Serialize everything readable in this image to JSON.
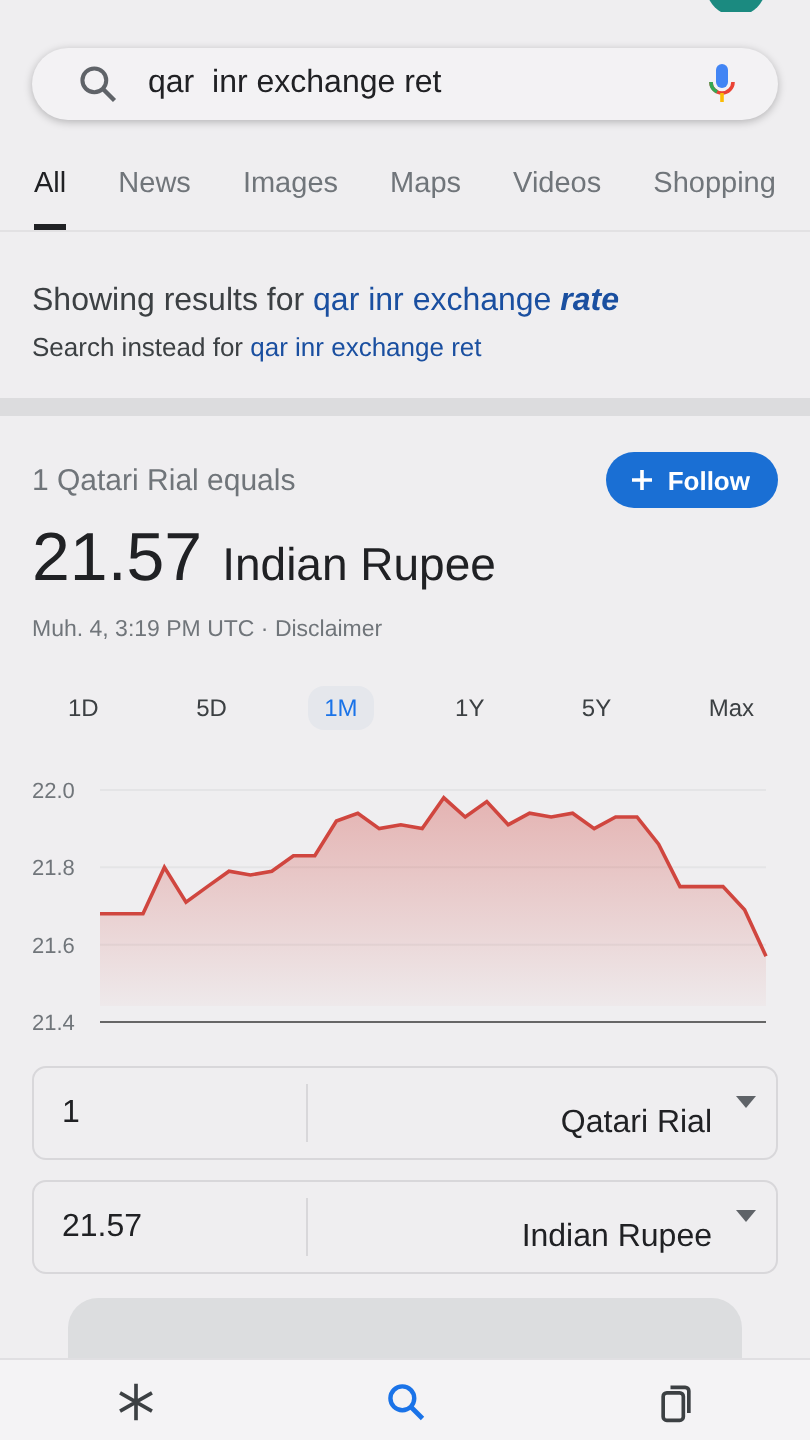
{
  "search": {
    "value": "qar  inr exchange ret"
  },
  "tabs": [
    {
      "label": "All",
      "selected": true
    },
    {
      "label": "News",
      "selected": false
    },
    {
      "label": "Images",
      "selected": false
    },
    {
      "label": "Maps",
      "selected": false
    },
    {
      "label": "Videos",
      "selected": false
    },
    {
      "label": "Shopping",
      "selected": false
    }
  ],
  "correction": {
    "showing_prefix": "Showing results for ",
    "showing_query": "qar inr exchange **rate**",
    "instead_prefix": "Search instead for ",
    "instead_query": "qar inr exchange ret"
  },
  "converter": {
    "equals_label": "1 Qatari Rial equals",
    "follow_label": "Follow",
    "value": "21.57",
    "currency": "Indian Rupee",
    "timestamp": "Muh. 4, 3:19 PM UTC · ",
    "disclaimer": "Disclaimer",
    "ranges": [
      {
        "label": "1D",
        "selected": false
      },
      {
        "label": "5D",
        "selected": false
      },
      {
        "label": "1M",
        "selected": true
      },
      {
        "label": "1Y",
        "selected": false
      },
      {
        "label": "5Y",
        "selected": false
      },
      {
        "label": "Max",
        "selected": false
      }
    ],
    "chart_data": {
      "type": "area",
      "series": [
        {
          "color": "#d0463f",
          "values": [
            21.68,
            21.68,
            21.68,
            21.8,
            21.71,
            21.75,
            21.79,
            21.78,
            21.79,
            21.83,
            21.83,
            21.92,
            21.94,
            21.9,
            21.91,
            21.9,
            21.98,
            21.93,
            21.97,
            21.91,
            21.94,
            21.93,
            21.94,
            21.9,
            21.93,
            21.93,
            21.86,
            21.75,
            21.75,
            21.75,
            21.69,
            21.57
          ]
        }
      ],
      "ylim": [
        21.4,
        22.0
      ],
      "yticks": [
        {
          "value": 22.0,
          "label": "22.0"
        },
        {
          "value": 21.8,
          "label": "21.8"
        },
        {
          "value": 21.6,
          "label": "21.6"
        },
        {
          "value": 21.4,
          "label": "21.4"
        }
      ]
    },
    "rows": [
      {
        "amount": "1",
        "currency": "Qatari Rial"
      },
      {
        "amount": "21.57",
        "currency": "Indian Rupee"
      }
    ]
  },
  "bottom_nav": [
    {
      "kind": "discover",
      "selected": false
    },
    {
      "kind": "search",
      "selected": true
    },
    {
      "kind": "tabs",
      "selected": false
    }
  ]
}
